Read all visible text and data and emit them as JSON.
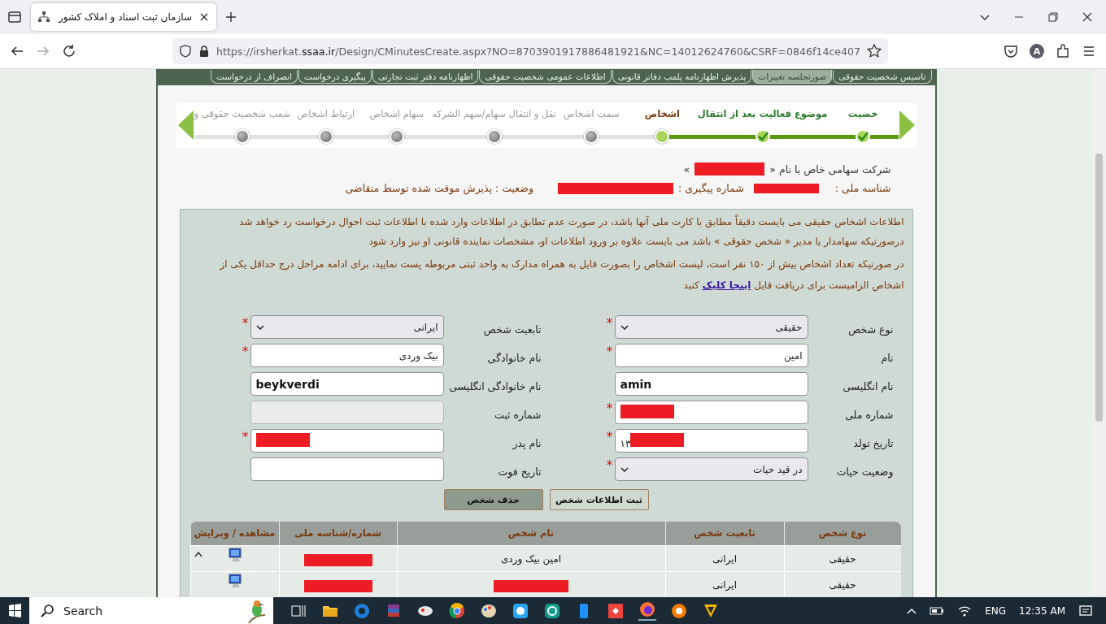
{
  "browser": {
    "tab_title": "سازمان ثبت اسناد و املاک کشور",
    "url": {
      "scheme": "https://irsherkat.",
      "host": "ssaa.ir",
      "path": "/Design/CMinutesCreate.aspx?NO=8703901917886481921&NC=14012624760&CSRF=0846f14ce407"
    },
    "profile_initial": "A"
  },
  "nav_tabs": [
    {
      "label": "تاسیس شخصیت حقوقی",
      "selected": false
    },
    {
      "label": "صورتجلسه تغییرات",
      "selected": true
    },
    {
      "label": "پذیرش اظهارنامه پلمب دفاتر قانونی",
      "selected": false
    },
    {
      "label": "اطلاعات عمومی شخصیت حقوقی",
      "selected": false
    },
    {
      "label": "اظهارنامه دفتر ثبت تجارتی",
      "selected": false
    },
    {
      "label": "پیگیری درخواست",
      "selected": false
    },
    {
      "label": "انصراف از درخواست",
      "selected": false
    }
  ],
  "steps": [
    {
      "label": "خصیت",
      "done": true,
      "current": false
    },
    {
      "label": "موضوع فعالیت بعد از انتقال",
      "done": true,
      "current": false
    },
    {
      "label": "اشخاص",
      "done": false,
      "current": true
    },
    {
      "label": "سمت اشخاص",
      "done": false,
      "current": false
    },
    {
      "label": "نقل و انتقال سهام/سهم الشرکه",
      "done": false,
      "current": false
    },
    {
      "label": "سهام اشخاص",
      "done": false,
      "current": false
    },
    {
      "label": "ارتباط اشخاص",
      "done": false,
      "current": false
    },
    {
      "label": "شعب شخصیت حقوقی و",
      "done": false,
      "current": false
    }
  ],
  "company": {
    "name_prefix": "شرکت سهامی خاص با نام «",
    "name_suffix": "»",
    "national_id_label": "شناسه ملی :",
    "tracking_label": "شماره پیگیری :",
    "status": "وضعیت : پذیرش موقت شده توسط متقاضی"
  },
  "notes": [
    "اطلاعات اشخاص حقیقی می بایست دقیقاً مطابق با کارت ملی آنها باشد، در صورت عدم تطابق در اطلاعات وارد شده با اطلاعات ثبت احوال درخواست رد خواهد شد",
    "درصورتیکه سهامدار یا مدیر « شخص حقوقی » باشد می بایست علاوه بر ورود اطلاعات او، مشخصات نماینده قانونی او نیز وارد شود"
  ],
  "download_note": {
    "text": "در صورتیکه تعداد اشخاص بیش از ۱۵۰ نفر است، لیست اشخاص را بصورت فایل به همراه مدارک به واحد ثبتی مربوطه پست نمایید، برای ادامه مراحل درج حداقل یکی از اشخاص الزامیست برای دریافت فایل",
    "link": "اینجا کلیک",
    "suffix": "کنید"
  },
  "form": {
    "fields": [
      {
        "label": "نوع شخص",
        "kind": "select",
        "value": "حقیقی",
        "required_mark": "*",
        "disabled": false
      },
      {
        "label": "تابعیت شخص",
        "kind": "select",
        "value": "ایرانی",
        "required_mark": "*",
        "disabled": false
      },
      {
        "label": "نام",
        "kind": "text",
        "value": "امین",
        "required_mark": "*",
        "disabled": false
      },
      {
        "label": "نام خانوادگی",
        "kind": "text",
        "value": "بیک وردی",
        "required_mark": "*",
        "disabled": false
      },
      {
        "label": "نام انگلیسی",
        "kind": "text",
        "value": "amin",
        "disabled": false
      },
      {
        "label": "نام خانوادگی انگلیسی",
        "kind": "text",
        "value": "beykverdi",
        "disabled": false
      },
      {
        "label": "شماره ملی",
        "kind": "text",
        "required_mark": "*",
        "disabled": false,
        "redacted": true
      },
      {
        "label": "شماره ثبت",
        "kind": "text",
        "disabled": true
      },
      {
        "label": "تاریخ تولد",
        "kind": "text",
        "value": "۱۳",
        "required_mark": "*",
        "disabled": false,
        "redacted": true
      },
      {
        "label": "نام پدر",
        "kind": "text",
        "required_mark": "*",
        "disabled": false,
        "redacted": true
      },
      {
        "label": "وضعیت حیات",
        "kind": "select",
        "value": "در قید حیات",
        "required_mark": "*",
        "disabled": false
      },
      {
        "label": "تاریخ فوت",
        "kind": "text",
        "disabled": false
      }
    ],
    "buttons": [
      {
        "label": "ثبت اطلاعات شخص",
        "kind": "primary"
      },
      {
        "label": "حذف شخص",
        "kind": "secondary"
      }
    ]
  },
  "table": {
    "columns": [
      "نوع شخص",
      "تابعیت شخص",
      "نام شخص",
      "شماره/شناسه ملی",
      "مشاهده / ویرایش"
    ],
    "rows": [
      {
        "person_type": "حقیقی",
        "nationality": "ایرانی",
        "name": "امین بیک وردی",
        "id_redacted": true
      },
      {
        "person_type": "حقیقی",
        "nationality": "ایرانی",
        "name_redacted": true,
        "id_redacted": true
      }
    ]
  },
  "taskbar": {
    "search": "Search",
    "language": "ENG",
    "time": "12:35 AM"
  }
}
